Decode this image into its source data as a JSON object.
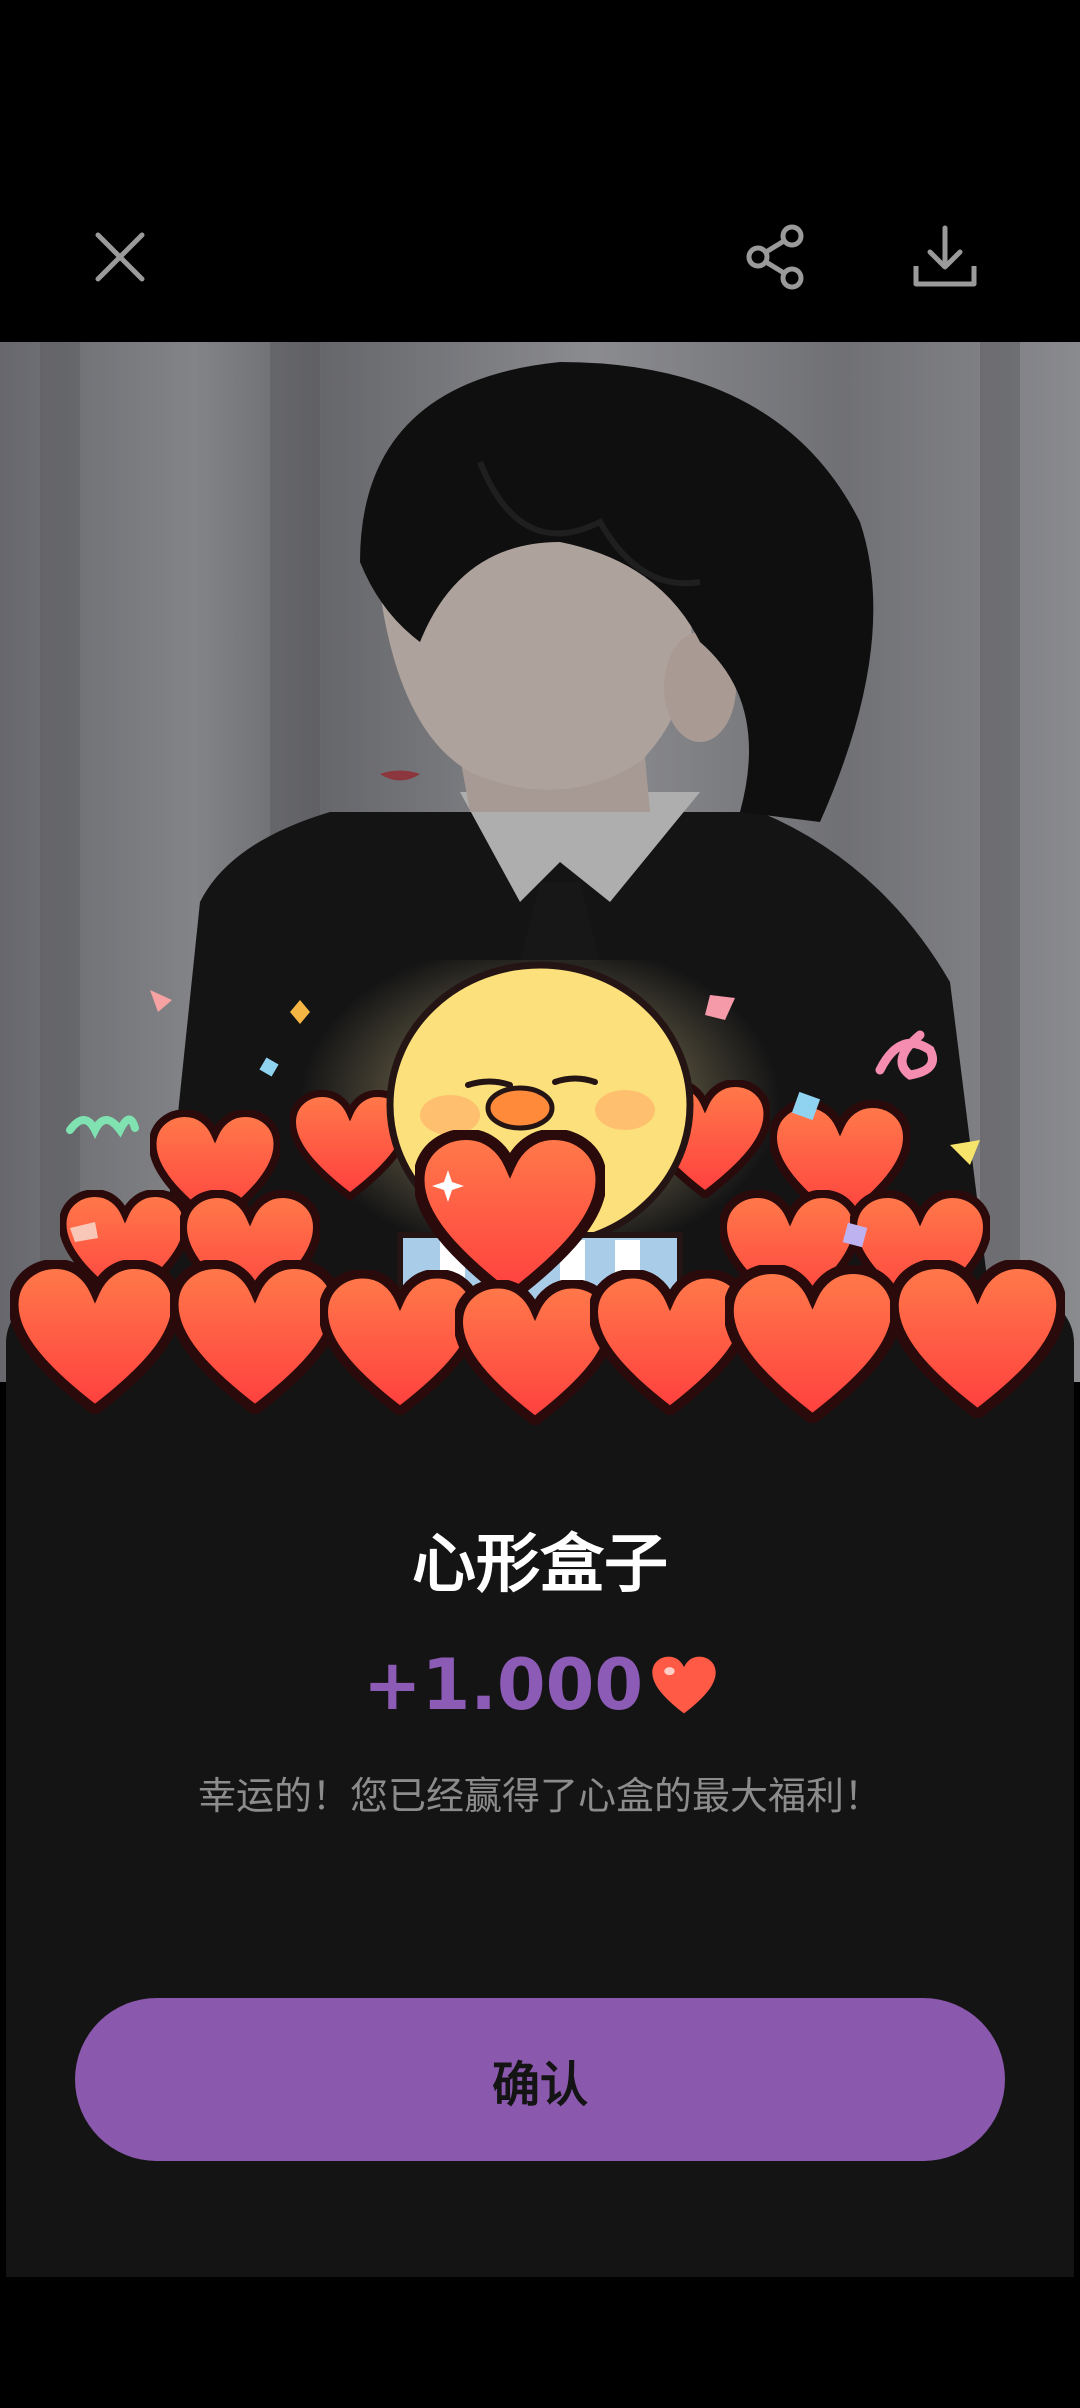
{
  "topbar": {
    "close_icon": "close-icon",
    "share_icon": "share-icon",
    "download_icon": "download-icon"
  },
  "dialog": {
    "title": "心形盒子",
    "amount": "+1.000",
    "reward_icon": "heart-icon",
    "description": "幸运的！您已经赢得了心盒的最大福利！",
    "confirm_label": "确认"
  },
  "colors": {
    "accent": "#8a58ad",
    "amount_text": "#8b5bb5",
    "sheet_bg": "#141414",
    "heart": "#ff5a45"
  }
}
